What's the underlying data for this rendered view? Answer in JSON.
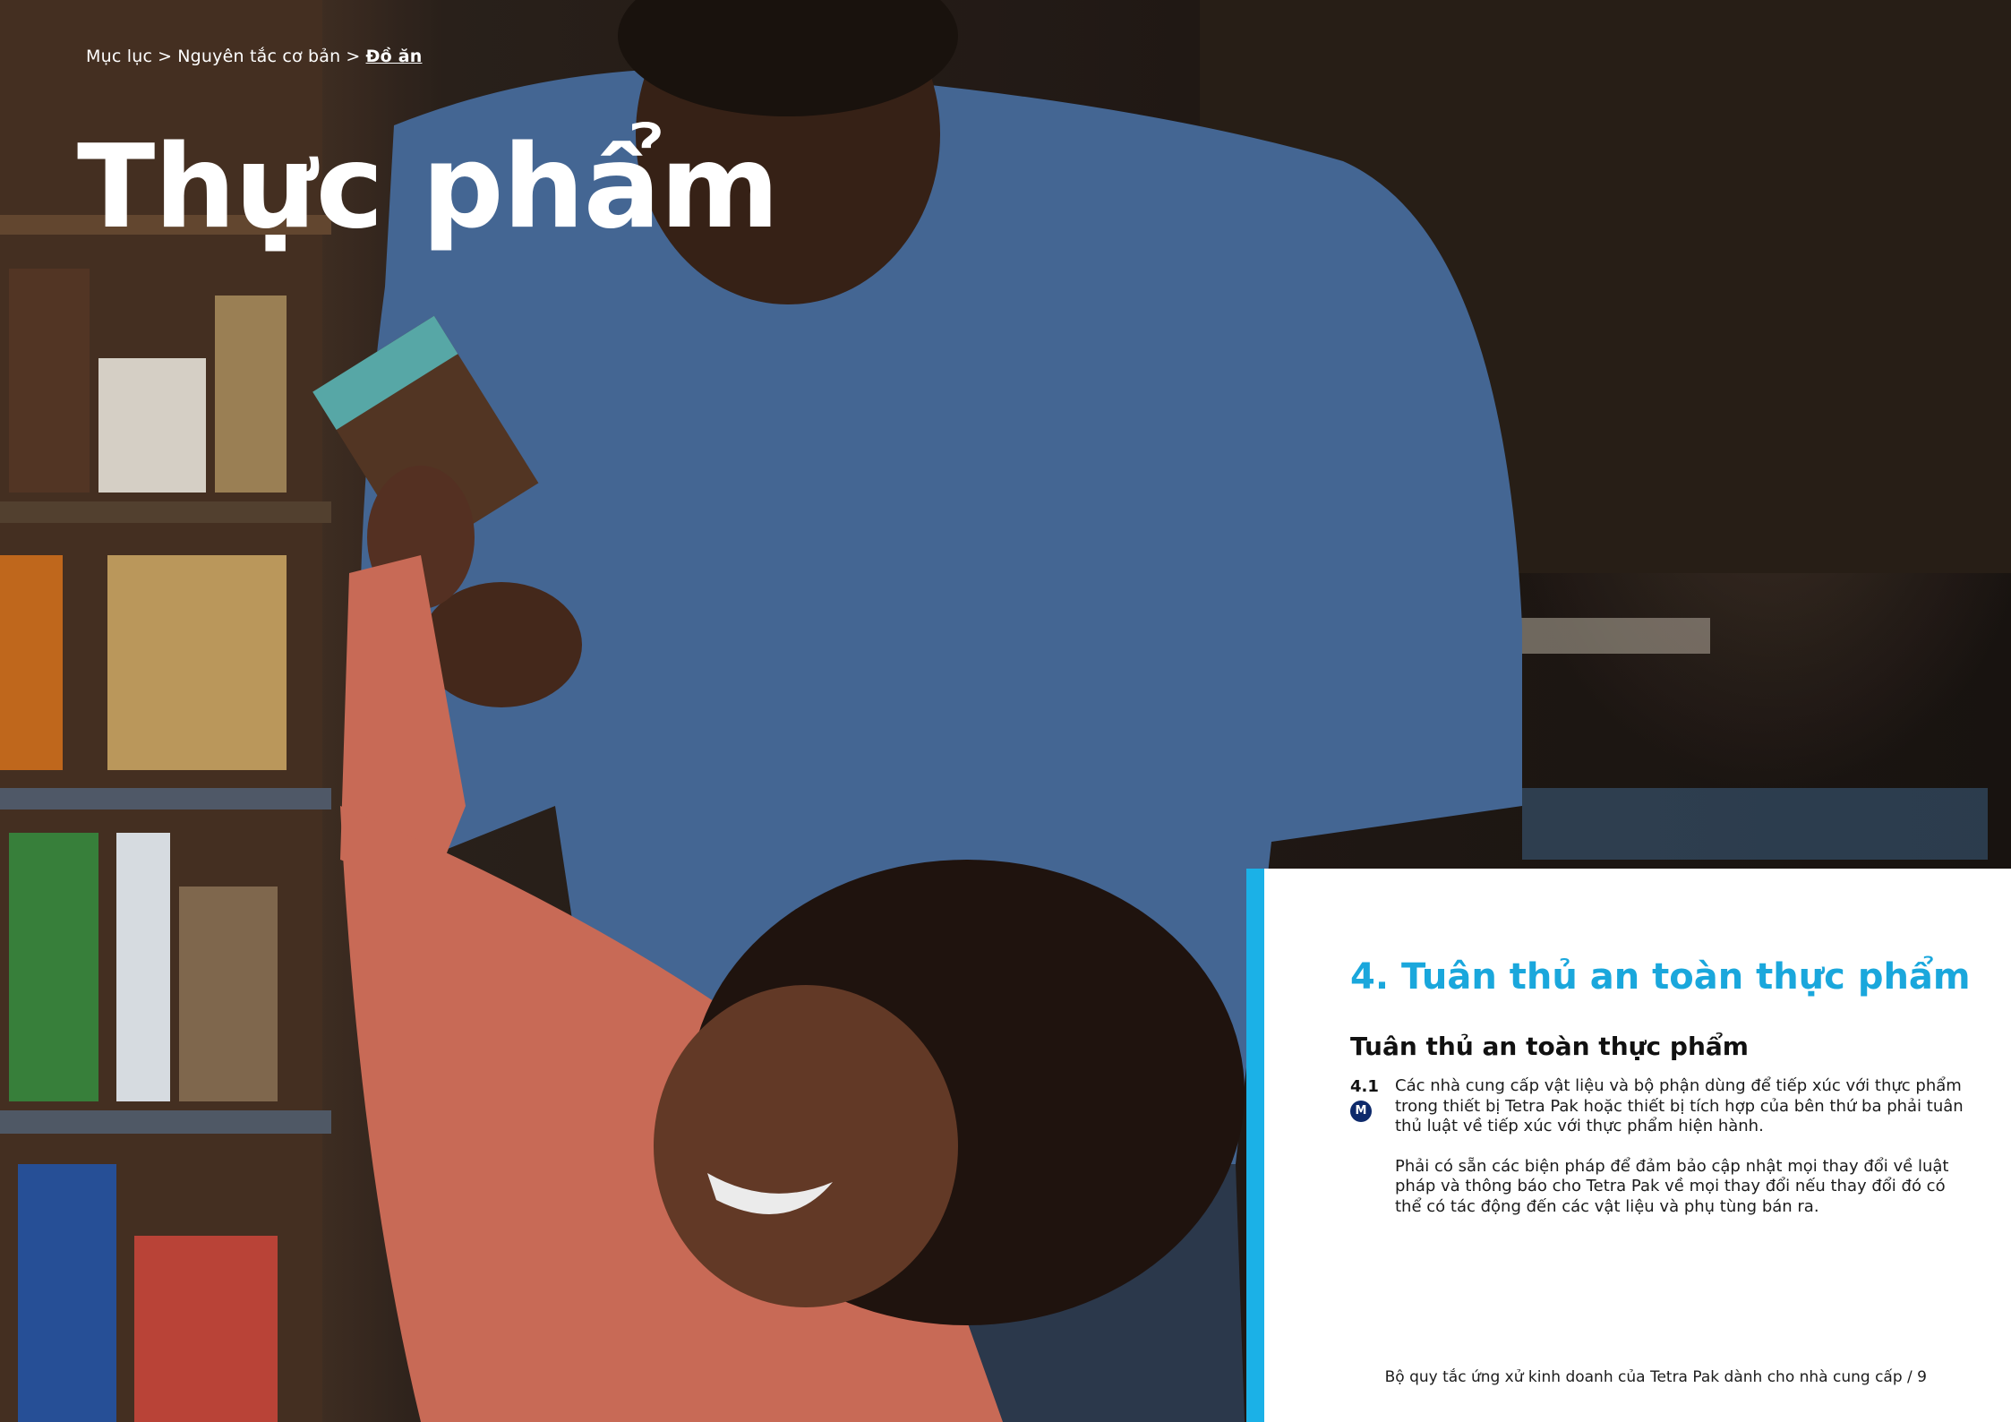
{
  "breadcrumb": {
    "items": [
      "Mục lục",
      "Nguyên tắc cơ bản"
    ],
    "current": "Đồ ăn",
    "separator": ">"
  },
  "page_title": "Thực phẩm",
  "panel": {
    "section_heading": "4. Tuân thủ an toàn thực phẩm",
    "sub_heading": "Tuân thủ an toàn thực phẩm",
    "clause_number": "4.1",
    "badge_label": "M",
    "paragraphs": [
      "Các nhà cung cấp vật liệu và bộ phận dùng để tiếp xúc với thực phẩm trong thiết bị Tetra Pak hoặc thiết bị tích hợp của bên thứ ba phải tuân thủ luật về tiếp xúc với thực phẩm hiện hành.",
      "Phải có sẵn các biện pháp để đảm bảo cập nhật mọi thay đổi về luật pháp và thông báo cho Tetra Pak về mọi thay đổi nếu thay đổi đó có thể có tác động đến các vật liệu và phụ tùng bán ra."
    ],
    "footer": "Bộ quy tắc ứng xử kinh doanh của Tetra Pak dành cho nhà cung cấp / 9"
  },
  "colors": {
    "accent_blue": "#1bb1e7",
    "heading_blue": "#1aa7dc",
    "badge_navy": "#0e2a6b",
    "sweater_blue": "#4a6fa0",
    "shirt_coral": "#d9735e"
  },
  "photo": {
    "subject": "man-and-child-in-grocery-aisle-image"
  }
}
